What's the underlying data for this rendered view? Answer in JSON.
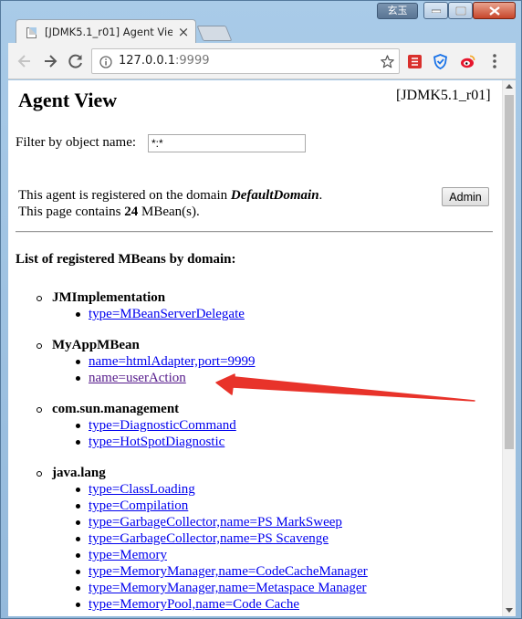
{
  "window": {
    "user_badge": "玄玉"
  },
  "tab": {
    "title": "[JDMK5.1_r01] Agent View",
    "close": "×"
  },
  "address_bar": {
    "host": "127.0.0.1",
    "port": ":9999"
  },
  "page": {
    "title": "Agent View",
    "version": "[JDMK5.1_r01]",
    "filter_label": "Filter by object name: ",
    "filter_value": "*:*",
    "domain_prefix": "This agent is registered on the domain ",
    "domain_name": "DefaultDomain",
    "domain_suffix": ".",
    "count_prefix": "This page contains ",
    "count": "24",
    "count_suffix": " MBean(s).",
    "admin_button": "Admin",
    "list_heading": "List of registered MBeans by domain:"
  },
  "domains": [
    {
      "name": "JMImplementation",
      "mbeans": [
        {
          "label": "type=MBeanServerDelegate",
          "visited": false
        }
      ]
    },
    {
      "name": "MyAppMBean",
      "mbeans": [
        {
          "label": "name=htmlAdapter,port=9999",
          "visited": false
        },
        {
          "label": "name=userAction",
          "visited": true
        }
      ]
    },
    {
      "name": "com.sun.management",
      "mbeans": [
        {
          "label": "type=DiagnosticCommand",
          "visited": false
        },
        {
          "label": "type=HotSpotDiagnostic",
          "visited": false
        }
      ]
    },
    {
      "name": "java.lang",
      "mbeans": [
        {
          "label": "type=ClassLoading",
          "visited": false
        },
        {
          "label": "type=Compilation",
          "visited": false
        },
        {
          "label": "type=GarbageCollector,name=PS MarkSweep",
          "visited": false
        },
        {
          "label": "type=GarbageCollector,name=PS Scavenge",
          "visited": false
        },
        {
          "label": "type=Memory",
          "visited": false
        },
        {
          "label": "type=MemoryManager,name=CodeCacheManager",
          "visited": false
        },
        {
          "label": "type=MemoryManager,name=Metaspace Manager",
          "visited": false
        },
        {
          "label": "type=MemoryPool,name=Code Cache",
          "visited": false
        }
      ]
    }
  ],
  "colors": {
    "link": "#0000ee",
    "visited_link": "#551a8b",
    "annotation_arrow": "#e8332a"
  }
}
